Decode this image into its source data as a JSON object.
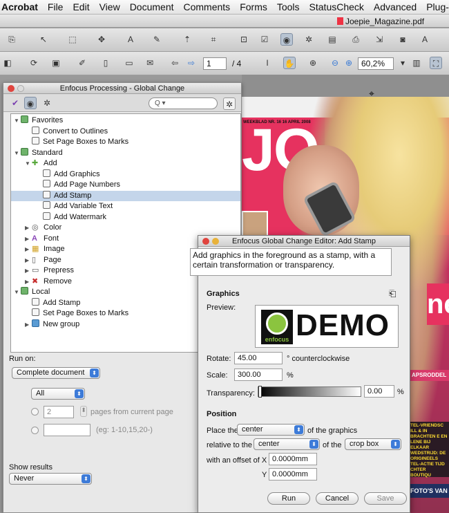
{
  "menubar": {
    "items": [
      "Acrobat",
      "File",
      "Edit",
      "View",
      "Document",
      "Comments",
      "Forms",
      "Tools",
      "StatusCheck",
      "Advanced",
      "Plug-Ins"
    ]
  },
  "window": {
    "title": "Joepie_Magazine.pdf"
  },
  "toolbar": {
    "page_current": "1",
    "page_total": "/ 4",
    "zoom": "60,2%"
  },
  "panel": {
    "title": "Enfocus Processing - Global Change",
    "search_placeholder": "Q",
    "tree": [
      {
        "label": "Favorites",
        "level": 0,
        "kind": "folder",
        "expanded": true
      },
      {
        "label": "Convert to Outlines",
        "level": 1,
        "kind": "page"
      },
      {
        "label": "Set Page Boxes to Marks",
        "level": 1,
        "kind": "page"
      },
      {
        "label": "Standard",
        "level": 0,
        "kind": "folder",
        "expanded": true
      },
      {
        "label": "Add",
        "level": 1,
        "kind": "plus",
        "expanded": true
      },
      {
        "label": "Add Graphics",
        "level": 2,
        "kind": "page"
      },
      {
        "label": "Add Page Numbers",
        "level": 2,
        "kind": "page"
      },
      {
        "label": "Add Stamp",
        "level": 2,
        "kind": "page",
        "selected": true
      },
      {
        "label": "Add Variable Text",
        "level": 2,
        "kind": "page"
      },
      {
        "label": "Add Watermark",
        "level": 2,
        "kind": "page"
      },
      {
        "label": "Color",
        "level": 1,
        "kind": "color",
        "expanded": false
      },
      {
        "label": "Font",
        "level": 1,
        "kind": "font",
        "expanded": false
      },
      {
        "label": "Image",
        "level": 1,
        "kind": "image",
        "expanded": false
      },
      {
        "label": "Page",
        "level": 1,
        "kind": "pg",
        "expanded": false
      },
      {
        "label": "Prepress",
        "level": 1,
        "kind": "prepress",
        "expanded": false
      },
      {
        "label": "Remove",
        "level": 1,
        "kind": "remove",
        "expanded": false
      },
      {
        "label": "Local",
        "level": 0,
        "kind": "folder",
        "expanded": true
      },
      {
        "label": "Add Stamp",
        "level": 1,
        "kind": "page"
      },
      {
        "label": "Set Page Boxes to Marks",
        "level": 1,
        "kind": "page"
      },
      {
        "label": "New group",
        "level": 1,
        "kind": "group",
        "expanded": false
      }
    ],
    "run_on_label": "Run on:",
    "run_on_value": "Complete document",
    "pages_select": "All",
    "pages_count": "2",
    "pages_from_label": "pages from current page",
    "range_hint": "(eg: 1-10,15,20-)",
    "show_results_label": "Show results",
    "show_results_value": "Never"
  },
  "dialog": {
    "title": "Enfocus Global Change Editor: Add Stamp",
    "description": "Add graphics in the foreground as a stamp, with a certain transformation or transparency.",
    "graphics_heading": "Graphics",
    "preview_label": "Preview:",
    "preview_text": "DEMO",
    "preview_brand": "enfocus",
    "rotate_label": "Rotate:",
    "rotate_value": "45.00",
    "rotate_unit": "° counterclockwise",
    "scale_label": "Scale:",
    "scale_value": "300.00",
    "scale_unit": "%",
    "transparency_label": "Transparency:",
    "transparency_value": "0.00",
    "transparency_unit": "%",
    "position_heading": "Position",
    "place_label": "Place the",
    "place_value": "center",
    "of_graphics": "of the graphics",
    "relative_label": "relative to the",
    "relative_value": "center",
    "of_the": "of the",
    "box_value": "crop box",
    "offset_label": "with an offset of  X",
    "offset_x": "0.0000mm",
    "y_label": "Y",
    "offset_y": "0.0000mm",
    "run_button": "Run",
    "cancel_button": "Cancel",
    "save_button": "Save"
  },
  "magazine": {
    "logo": "JO",
    "issue": "WEEKBLAD NR. 16  16 APRIL 2008",
    "cover_letters": "ne",
    "stripe": "APSRODDEL",
    "tease": "TEL-VRIENDSC ILL & IN BRACHTEN E EN LENE BIJ ELKAAR WEDSTRIJD: DE ORIGINEELS TEL-ACTIE TIJD CHTER BOUTIQU",
    "footer": "FOTO'S VAN"
  },
  "colors": {
    "selection": "#c4d5ea",
    "accent": "#3d7bd8",
    "cover_pink": "#e6325f"
  }
}
